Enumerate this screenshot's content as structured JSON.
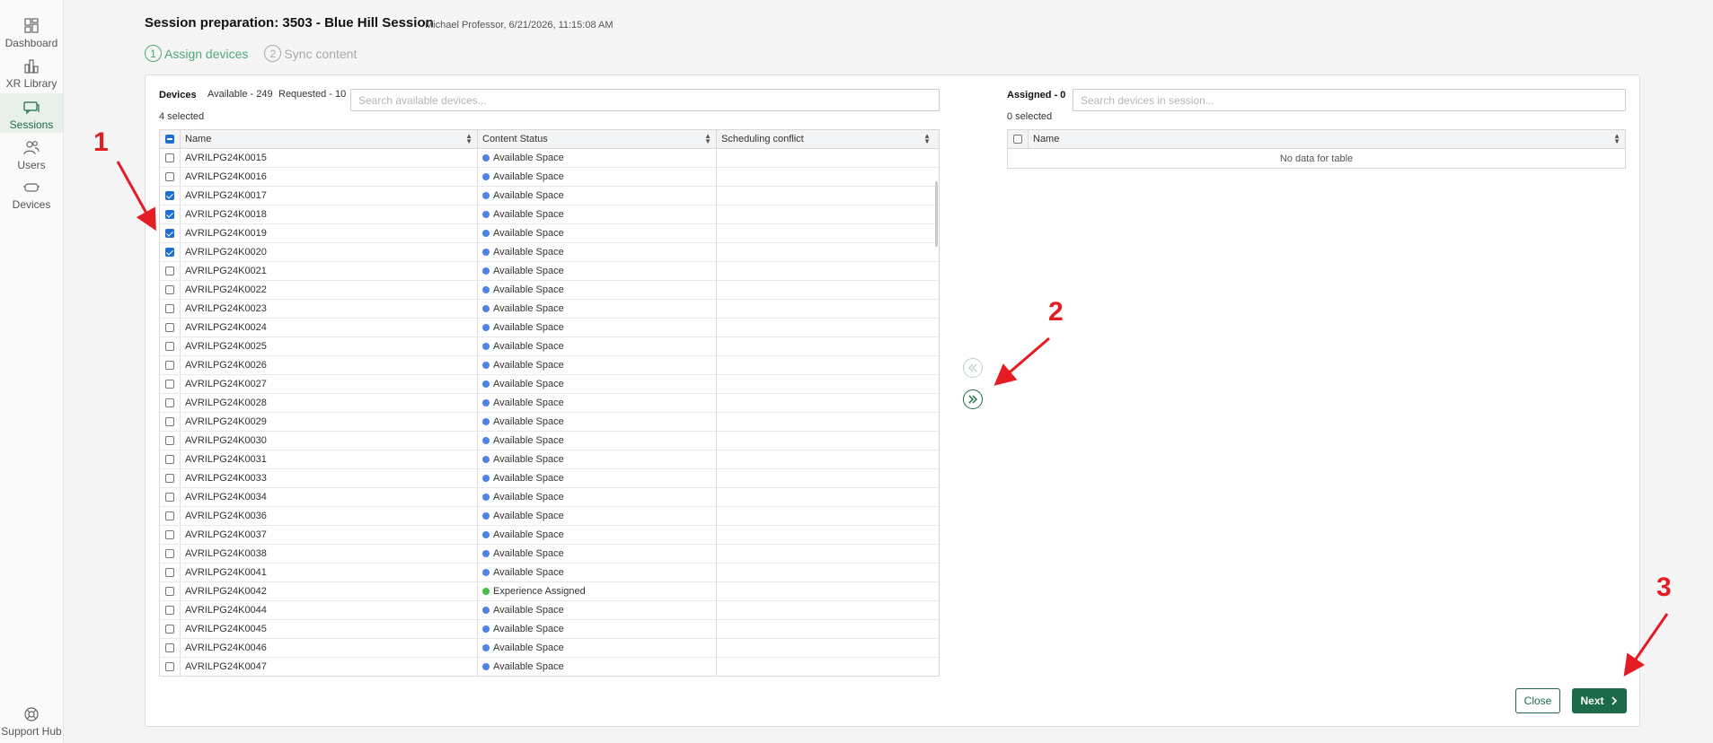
{
  "sidebar": {
    "items": [
      {
        "label": "Dashboard",
        "icon": "dashboard-icon"
      },
      {
        "label": "XR Library",
        "icon": "library-icon"
      },
      {
        "label": "Sessions",
        "icon": "sessions-icon",
        "active": true
      },
      {
        "label": "Users",
        "icon": "users-icon"
      },
      {
        "label": "Devices",
        "icon": "devices-icon"
      }
    ],
    "support": {
      "label": "Support Hub",
      "icon": "lifebuoy-icon"
    }
  },
  "header": {
    "title": "Session preparation: 3503 - Blue Hill Session",
    "meta": "Michael Professor, 6/21/2026, 11:15:08 AM"
  },
  "steps": [
    {
      "num": "1",
      "label": "Assign devices",
      "state": "active"
    },
    {
      "num": "2",
      "label": "Sync content",
      "state": "inactive"
    }
  ],
  "devices": {
    "title": "Devices",
    "available": "Available - 249",
    "requested": "Requested - 10",
    "selected": "4 selected",
    "search_placeholder": "Search available devices...",
    "columns": [
      "Name",
      "Content Status",
      "Scheduling conflict"
    ],
    "rows": [
      {
        "name": "AVRILPG24K0015",
        "status": "Available Space",
        "checked": false
      },
      {
        "name": "AVRILPG24K0016",
        "status": "Available Space",
        "checked": false
      },
      {
        "name": "AVRILPG24K0017",
        "status": "Available Space",
        "checked": true
      },
      {
        "name": "AVRILPG24K0018",
        "status": "Available Space",
        "checked": true
      },
      {
        "name": "AVRILPG24K0019",
        "status": "Available Space",
        "checked": true
      },
      {
        "name": "AVRILPG24K0020",
        "status": "Available Space",
        "checked": true
      },
      {
        "name": "AVRILPG24K0021",
        "status": "Available Space",
        "checked": false
      },
      {
        "name": "AVRILPG24K0022",
        "status": "Available Space",
        "checked": false
      },
      {
        "name": "AVRILPG24K0023",
        "status": "Available Space",
        "checked": false
      },
      {
        "name": "AVRILPG24K0024",
        "status": "Available Space",
        "checked": false
      },
      {
        "name": "AVRILPG24K0025",
        "status": "Available Space",
        "checked": false
      },
      {
        "name": "AVRILPG24K0026",
        "status": "Available Space",
        "checked": false
      },
      {
        "name": "AVRILPG24K0027",
        "status": "Available Space",
        "checked": false
      },
      {
        "name": "AVRILPG24K0028",
        "status": "Available Space",
        "checked": false
      },
      {
        "name": "AVRILPG24K0029",
        "status": "Available Space",
        "checked": false
      },
      {
        "name": "AVRILPG24K0030",
        "status": "Available Space",
        "checked": false
      },
      {
        "name": "AVRILPG24K0031",
        "status": "Available Space",
        "checked": false
      },
      {
        "name": "AVRILPG24K0033",
        "status": "Available Space",
        "checked": false
      },
      {
        "name": "AVRILPG24K0034",
        "status": "Available Space",
        "checked": false
      },
      {
        "name": "AVRILPG24K0036",
        "status": "Available Space",
        "checked": false
      },
      {
        "name": "AVRILPG24K0037",
        "status": "Available Space",
        "checked": false
      },
      {
        "name": "AVRILPG24K0038",
        "status": "Available Space",
        "checked": false
      },
      {
        "name": "AVRILPG24K0041",
        "status": "Available Space",
        "checked": false
      },
      {
        "name": "AVRILPG24K0042",
        "status": "Experience Assigned",
        "checked": false
      },
      {
        "name": "AVRILPG24K0044",
        "status": "Available Space",
        "checked": false
      },
      {
        "name": "AVRILPG24K0045",
        "status": "Available Space",
        "checked": false
      },
      {
        "name": "AVRILPG24K0046",
        "status": "Available Space",
        "checked": false
      },
      {
        "name": "AVRILPG24K0047",
        "status": "Available Space",
        "checked": false
      }
    ],
    "status_colors": {
      "Available Space": "#4a86e8",
      "Experience Assigned": "#4cbb47"
    }
  },
  "assigned": {
    "title": "Assigned - 0",
    "selected": "0 selected",
    "search_placeholder": "Search devices in session...",
    "columns": [
      "Name"
    ],
    "empty_text": "No data for table"
  },
  "transfer": {
    "remove_icon": "double-chevron-left-icon",
    "add_icon": "double-chevron-right-icon"
  },
  "footer": {
    "close_label": "Close",
    "next_label": "Next"
  },
  "annotations": [
    "1",
    "2",
    "3"
  ],
  "colors": {
    "brand": "#1b6b48",
    "step_active": "#4fa978",
    "annotation": "#e41c24"
  }
}
